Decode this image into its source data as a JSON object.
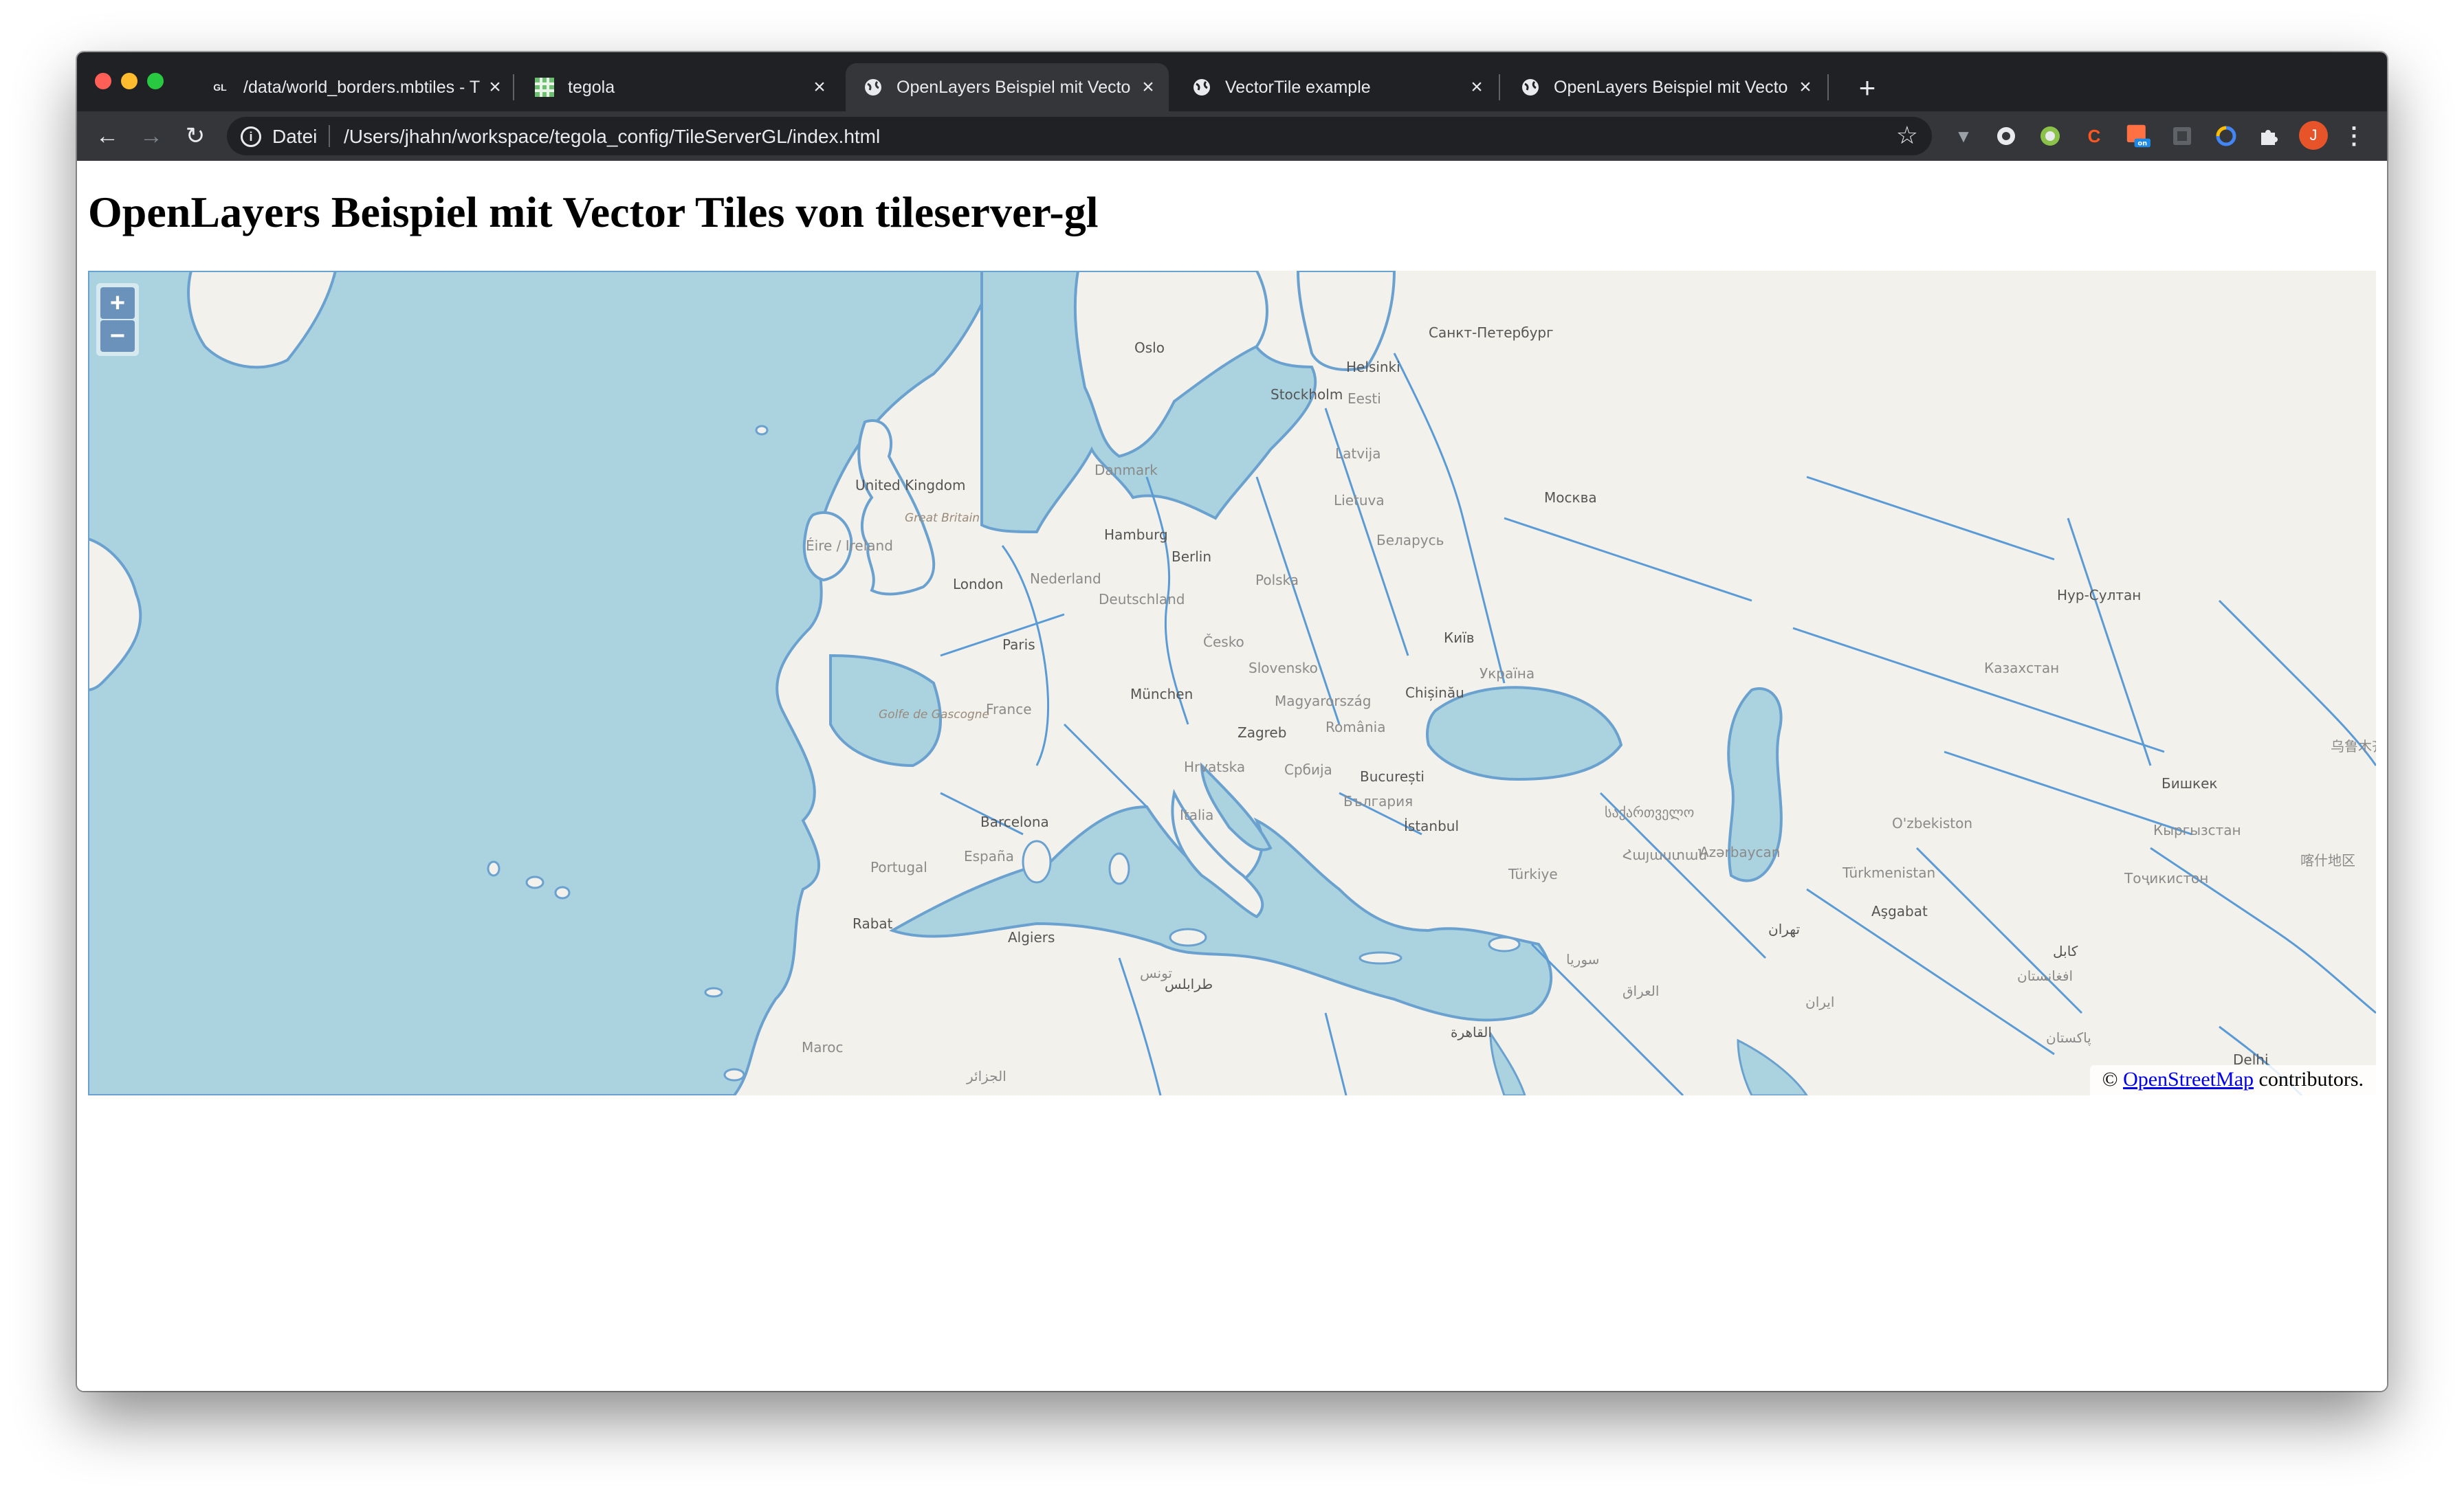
{
  "browser": {
    "tabs": [
      {
        "title": "/data/world_borders.mbtiles - T",
        "icon": "gl-logo-icon",
        "active": false
      },
      {
        "title": "tegola",
        "icon": "tegola-icon",
        "active": false
      },
      {
        "title": "OpenLayers Beispiel mit Vecto",
        "icon": "globe-icon",
        "active": true
      },
      {
        "title": "VectorTile example",
        "icon": "globe-icon",
        "active": false
      },
      {
        "title": "OpenLayers Beispiel mit Vecto",
        "icon": "globe-icon",
        "active": false
      }
    ],
    "favicon_gl_text": "GL",
    "close_glyph": "×",
    "new_tab_glyph": "+",
    "omnibox": {
      "scheme_label": "Datei",
      "url": "/Users/jhahn/workspace/tegola_config/TileServerGL/index.html"
    },
    "extensions": [
      "vue-devtools-icon",
      "circle-extension-icon",
      "green-extension-icon",
      "c-extension-icon",
      "calendar-extension-icon",
      "grey-extension-icon",
      "colorful-extension-icon",
      "puzzle-icon",
      "profile-avatar",
      "more-icon"
    ],
    "extension_badge": "on",
    "profile_initial": "J",
    "colors": {
      "tabstrip": "#202124",
      "toolbar": "#35363a",
      "avatar": "#e8542a"
    }
  },
  "page": {
    "heading": "OpenLayers Beispiel mit Vector Tiles von tileserver-gl",
    "map": {
      "zoom_in": "+",
      "zoom_out": "−",
      "attribution_prefix": "©",
      "attribution_link": "OpenStreetMap",
      "attribution_suffix": "contributors.",
      "water_color": "#aad3df",
      "land_color": "#f3f1ec",
      "border_color": "#5b9bd5",
      "labels": {
        "oslo": "Oslo",
        "stockholm": "Stockholm",
        "helsinki": "Helsinki",
        "spb": "Санкт-Петербург",
        "eesti": "Eesti",
        "latvija": "Latvija",
        "lietuva": "Lietuva",
        "moskva": "Москва",
        "uk": "United Kingdom",
        "gb": "Great Britain",
        "ireland": "Éire / Ireland",
        "danmark": "Danmark",
        "hamburg": "Hamburg",
        "berlin": "Berlin",
        "polska": "Polska",
        "belarus": "Беларусь",
        "london": "London",
        "nederland": "Nederland",
        "deutschland": "Deutschland",
        "paris": "Paris",
        "cesko": "Česko",
        "kyiv": "Київ",
        "ukraina": "Україна",
        "nursultan": "Нур-Султан",
        "kazakhstan": "Казахстан",
        "slovensko": "Slovensko",
        "munchen": "München",
        "chisinau": "Chișinău",
        "france": "France",
        "magyarorszag": "Magyarország",
        "romania": "România",
        "golfe": "Golfe de Gascogne",
        "zagreb": "Zagreb",
        "hrvatska": "Hrvatska",
        "srbija": "Србија",
        "bucuresti": "București",
        "bulgaria": "България",
        "urumqi": "乌鲁木齐市",
        "bishkek": "Бишкек",
        "italia": "Italia",
        "barcelona": "Barcelona",
        "istanbul": "İstanbul",
        "sakartvelo": "საქართველო",
        "azerbaycan": "Azərbaycan",
        "ozbekiston": "O'zbekiston",
        "kyrgyzstan": "Кыргызстан",
        "kashgar": "喀什地区",
        "portugal": "Portugal",
        "espana": "España",
        "turkiye": "Türkiye",
        "hayastan": "Հայաստան",
        "turkmenistan": "Türkmenistan",
        "tojikiston": "Тоҷикистон",
        "ashgabat": "Aşgabat",
        "rabat": "Rabat",
        "algiers": "Algiers",
        "tunis": "تونس",
        "tehran": "تهران",
        "suriya": "سوريا",
        "iraq": "العراق",
        "iran": "ايران",
        "kabul": "کابل",
        "afghanistan": "افغانستان",
        "tarabulus": "طرابلس",
        "maroc": "Maroc",
        "jazair": "الجزائر",
        "qahira": "القاهرة",
        "delhi": "Delhi",
        "pakistan": "پاکستان"
      }
    }
  }
}
